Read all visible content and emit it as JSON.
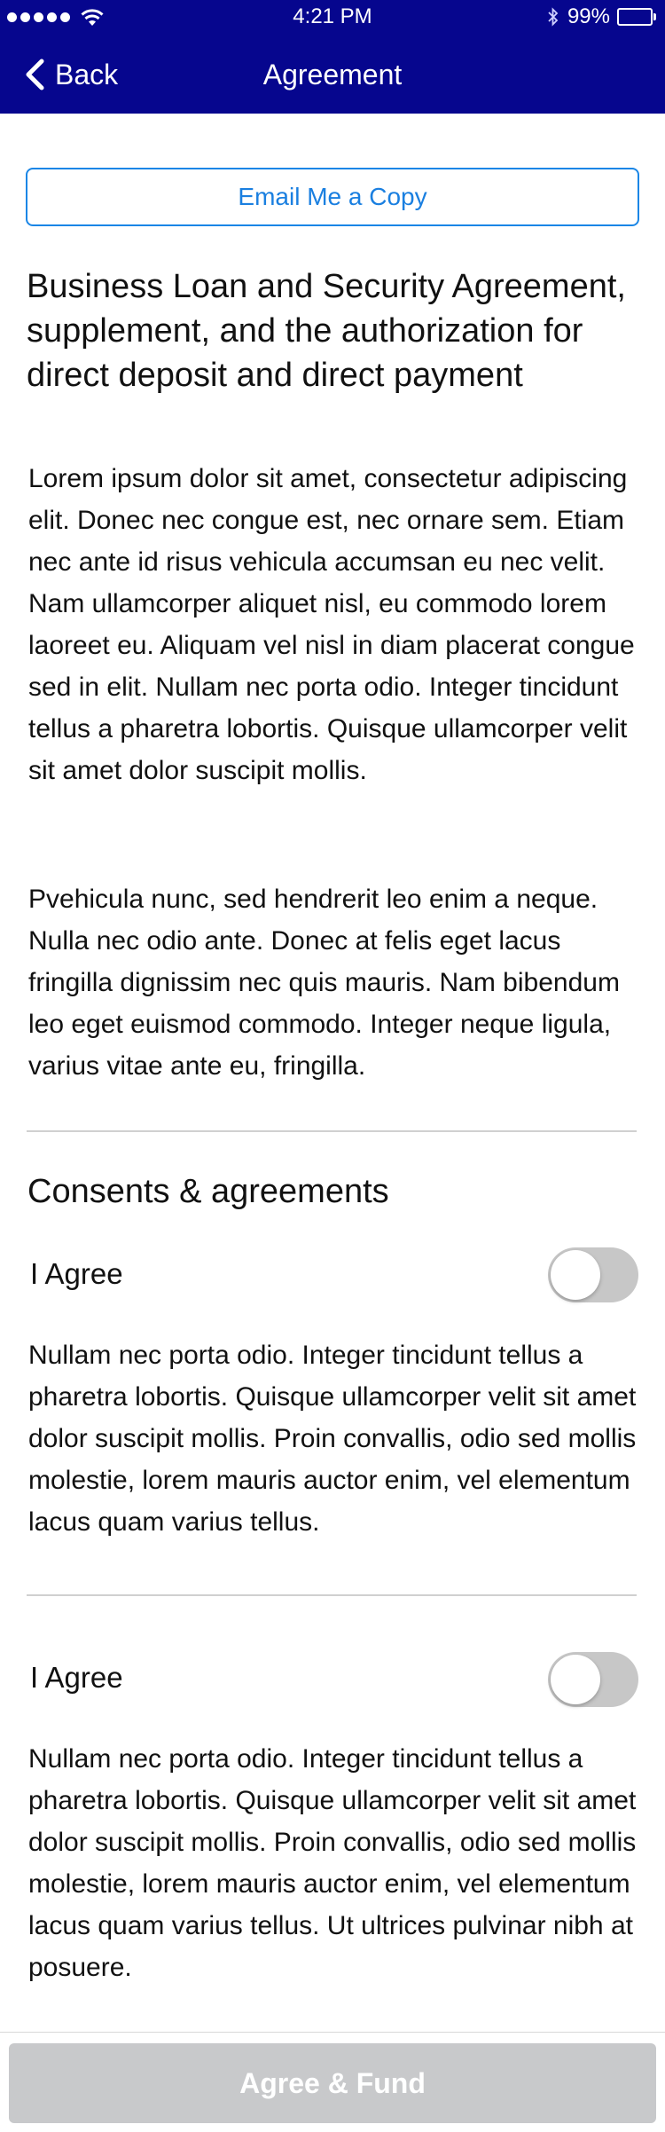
{
  "status_bar": {
    "time": "4:21 PM",
    "battery": "99%",
    "signal_dots": 5,
    "icons": [
      "signal-dots-icon",
      "wifi-icon",
      "bluetooth-icon",
      "battery-icon"
    ]
  },
  "nav": {
    "back_label": "Back",
    "title": "Agreement",
    "background_color": "#06068e"
  },
  "email_button": {
    "label": "Email Me a Copy",
    "color": "#1a7fe0"
  },
  "document": {
    "title": "Business Loan and Security Agreement, supplement, and the authorization for direct deposit and direct payment",
    "paragraphs": [
      "Lorem ipsum dolor sit amet, consectetur adipiscing elit. Donec nec congue est, nec ornare sem. Etiam nec ante id risus vehicula accumsan eu nec velit. Nam ullamcorper aliquet nisl, eu commodo lorem laoreet eu. Aliquam vel nisl in diam placerat congue sed in elit. Nullam nec porta odio. Integer tincidunt tellus a pharetra lobortis. Quisque ullamcorper velit sit amet dolor suscipit mollis.",
      "Pvehicula nunc, sed hendrerit leo enim a neque. Nulla nec odio ante. Donec at felis eget lacus fringilla dignissim nec quis mauris. Nam bibendum leo eget euismod commodo. Integer neque ligula, varius vitae ante eu, fringilla."
    ]
  },
  "consents": {
    "title": "Consents & agreements",
    "items": [
      {
        "label": "I Agree",
        "checked": false,
        "text": "Nullam nec porta odio. Integer tincidunt tellus a pharetra lobortis. Quisque ullamcorper velit sit amet dolor suscipit mollis. Proin convallis, odio sed mollis molestie, lorem mauris auctor enim, vel elementum lacus quam varius tellus."
      },
      {
        "label": "I Agree",
        "checked": false,
        "text": "Nullam nec porta odio. Integer tincidunt tellus a pharetra lobortis. Quisque ullamcorper velit sit amet dolor suscipit mollis. Proin convallis, odio sed mollis molestie, lorem mauris auctor enim, vel elementum lacus quam varius tellus. Ut ultrices pulvinar nibh at posuere."
      }
    ]
  },
  "footer": {
    "fund_label": "Agree & Fund",
    "fund_enabled": false,
    "disabled_color": "#c8c9cb"
  }
}
